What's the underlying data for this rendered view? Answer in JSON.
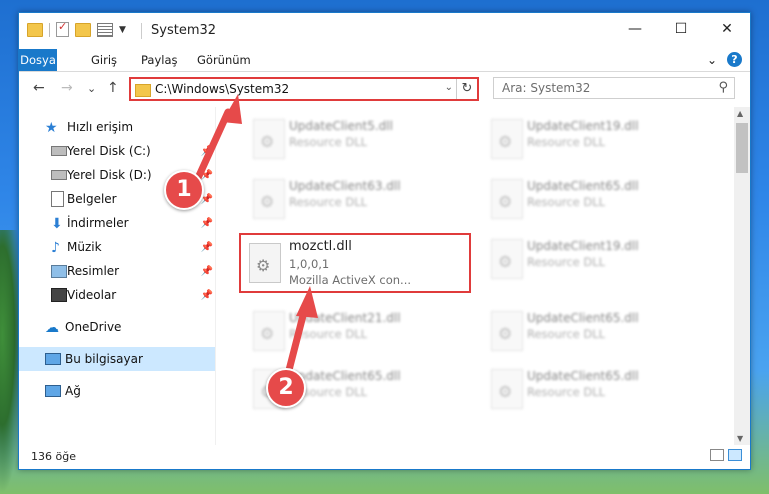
{
  "window": {
    "title": "System32",
    "buttons": {
      "minimize": "—",
      "maximize": "☐",
      "close": "✕"
    }
  },
  "ribbon": {
    "tabs": [
      "Dosya",
      "Giriş",
      "Paylaş",
      "Görünüm"
    ],
    "expand": "⌄",
    "help": "?"
  },
  "nav_buttons": {
    "back": "←",
    "forward": "→",
    "recent": "⌄",
    "up": "↑"
  },
  "address": {
    "path": "C:\\Windows\\System32",
    "dropdown": "⌄",
    "refresh": "↻"
  },
  "search": {
    "placeholder": "Ara: System32",
    "icon": "⚲"
  },
  "sidebar": {
    "items": [
      {
        "label": "Hızlı erişim",
        "icon": "star-icon"
      },
      {
        "label": "Yerel Disk (C:)",
        "icon": "drive-icon",
        "pinned": true
      },
      {
        "label": "Yerel Disk (D:)",
        "icon": "drive-icon",
        "pinned": true
      },
      {
        "label": "Belgeler",
        "icon": "documents-icon",
        "pinned": true
      },
      {
        "label": "İndirmeler",
        "icon": "downloads-icon",
        "pinned": true
      },
      {
        "label": "Müzik",
        "icon": "music-icon",
        "pinned": true
      },
      {
        "label": "Resimler",
        "icon": "pictures-icon",
        "pinned": true
      },
      {
        "label": "Videolar",
        "icon": "videos-icon",
        "pinned": true
      },
      {
        "label": "OneDrive",
        "icon": "cloud-icon"
      },
      {
        "label": "Bu bilgisayar",
        "icon": "computer-icon",
        "selected": true
      },
      {
        "label": "Ağ",
        "icon": "network-icon"
      }
    ],
    "pin_glyph": "📌"
  },
  "files": {
    "left": [
      {
        "name": "UpdateClient5.dll",
        "desc": "Resource DLL"
      },
      {
        "name": "UpdateClient63.dll",
        "desc": "Resource DLL"
      },
      {
        "name": "UpdateClient21.dll",
        "desc": "Resource DLL"
      },
      {
        "name": "UpdateClient65.dll",
        "desc": "Resource DLL"
      }
    ],
    "right": [
      {
        "name": "UpdateClient19.dll",
        "desc": "Resource DLL"
      },
      {
        "name": "UpdateClient65.dll",
        "desc": "Resource DLL"
      },
      {
        "name": "UpdateClient19.dll",
        "desc": "Resource DLL"
      },
      {
        "name": "UpdateClient65.dll",
        "desc": "Resource DLL"
      },
      {
        "name": "UpdateClient65.dll",
        "desc": "Resource DLL"
      }
    ],
    "highlighted": {
      "name": "mozctl.dll",
      "version": "1,0,0,1",
      "desc": "Mozilla ActiveX con..."
    }
  },
  "status": {
    "count": "136 öğe"
  },
  "callouts": [
    "1",
    "2"
  ],
  "colors": {
    "accent": "#1979ca",
    "annotation": "#e03b3b",
    "selected": "#cce8ff"
  }
}
